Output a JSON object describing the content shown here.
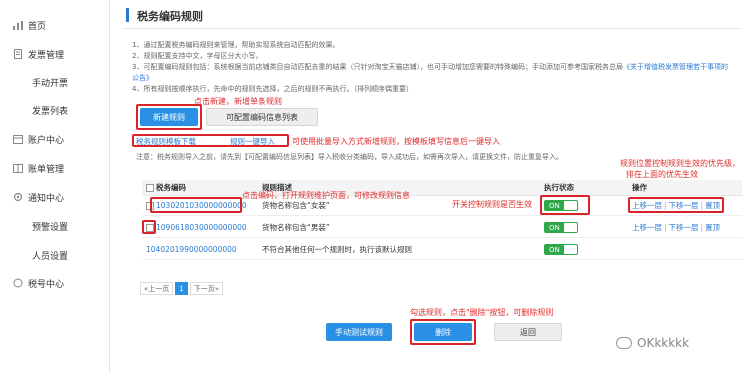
{
  "sidebar": {
    "items": [
      {
        "label": "首页",
        "icon": "bar-chart-icon"
      },
      {
        "label": "发票管理",
        "icon": "document-icon"
      },
      {
        "label": "账户中心",
        "icon": "account-icon"
      },
      {
        "label": "账单管理",
        "icon": "bill-icon"
      },
      {
        "label": "通知中心",
        "icon": "gear-icon"
      },
      {
        "label": "税号中心",
        "icon": "circle-icon"
      }
    ],
    "subitems": [
      "手动开票",
      "发票列表",
      "预警设置",
      "人员设置"
    ]
  },
  "page": {
    "title": "税务编码规则",
    "notes": [
      "1、通过配置税务编码规则来管理，帮助实现系统自动匹配的效果。",
      "2、规则配置支持中文，字母区分大小写。",
      "3、可配置编码规则包括：系统根据当前店铺类目自动匹配去重的结果（只针对淘宝天猫店铺），也可手动增加您需要的特殊编码；手动添加可参考国家税务总局",
      "《关于增值税发票管理若干事项的公告》",
      "4、所有规则按顺序执行，先命中的规则先选择，之后的规则不再执行。（排列顺序偶重要）"
    ]
  },
  "toolbar": {
    "new_rule": "新建规则",
    "config_list": "可配置编码信息列表",
    "download_template": "税务规则模板下载",
    "import": "规则一键导入",
    "notice": "注意：税务规则导入之前，请先到【可配置编码信息列表】导入税收分类编码，导入成功后，如需再次导入，请更换文件，防止重复导入。"
  },
  "annotations": {
    "new": "点击新建，新增单条规则",
    "batch": "可使用批量导入方式新增规则，按模板填写信息后一键导入",
    "priority_line1": "规则位置控制规则生效的优先级，",
    "priority_line2": "排在上面的优先生效",
    "edit": "点击编码，打开规则维护页面，可修改规则信息",
    "toggle": "开关控制规则是否生效",
    "delete": "勾选规则，点击\"删除\"按钮，可删除规则"
  },
  "table": {
    "headers": {
      "code": "税务编码",
      "desc": "规则描述",
      "status": "执行状态",
      "ops": "操作"
    },
    "rows": [
      {
        "code": "1030201030000000000",
        "desc": "货物名称包含“女装”",
        "status": "ON",
        "ops": [
          "上移一层",
          "下移一层",
          "置顶"
        ]
      },
      {
        "code": "1090618030000000000",
        "desc": "货物名称包含“男装”",
        "status": "ON",
        "ops": [
          "上移一层",
          "下移一层",
          "置顶"
        ]
      },
      {
        "code": "1040201990000000000",
        "desc": "不符合其他任何一个规则时，执行该默认规则",
        "status": "ON",
        "ops": []
      }
    ]
  },
  "pager": {
    "prev": "«上一页",
    "page": "1",
    "next": "下一页»"
  },
  "bottom": {
    "test": "手动测试规则",
    "delete": "删除",
    "back": "返回"
  },
  "watermark": "OKkkkkk",
  "colors": {
    "accent": "#2a90e6",
    "annotation": "#e02b2b",
    "toggle_on": "#2ea84a"
  }
}
